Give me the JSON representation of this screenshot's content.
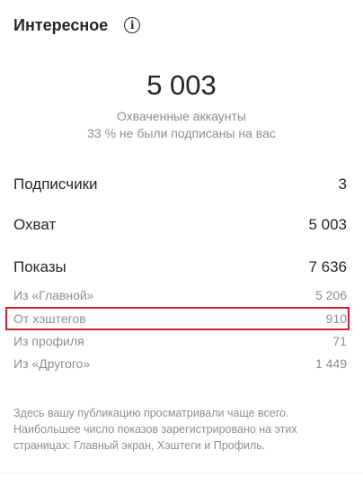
{
  "header": {
    "title": "Интересное",
    "info_icon": "info-icon"
  },
  "reach": {
    "value": "5 003",
    "label": "Охваченные аккаунты",
    "note": "33 % не были подписаны на вас"
  },
  "metrics": {
    "followers": {
      "label": "Подписчики",
      "value": "3"
    },
    "reach": {
      "label": "Охват",
      "value": "5 003"
    },
    "impressions": {
      "label": "Показы",
      "value": "7 636"
    }
  },
  "sources": [
    {
      "label": "Из «Главной»",
      "value": "5 206"
    },
    {
      "label": "От хэштегов",
      "value": "910"
    },
    {
      "label": "Из профиля",
      "value": "71"
    },
    {
      "label": "Из «Другого»",
      "value": "1 449"
    }
  ],
  "highlight_color": "#d0202a",
  "footnote": "Здесь вашу публикацию просматривали чаще всего. Наибольшее число показов зарегистрировано на этих страницах: Главный экран, Хэштеги и Профиль."
}
